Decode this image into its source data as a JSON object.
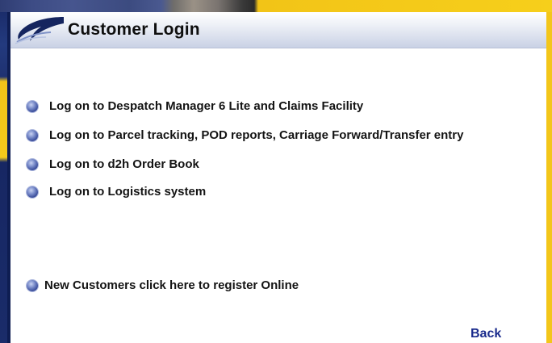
{
  "header": {
    "title": "Customer Login",
    "logo_icon": "swoosh-logo-icon"
  },
  "menu": {
    "items": [
      {
        "label": "Log on to Despatch Manager 6 Lite and Claims Facility",
        "icon": "bullet-icon"
      },
      {
        "label": "Log on to Parcel tracking, POD reports, Carriage Forward/Transfer entry",
        "icon": "bullet-icon"
      },
      {
        "label": "Log on to d2h Order Book",
        "icon": "bullet-icon"
      },
      {
        "label": "Log on to Logistics system",
        "icon": "bullet-icon"
      }
    ]
  },
  "register": {
    "label": "New Customers click here to register Online",
    "icon": "bullet-icon"
  },
  "back": {
    "label": "Back"
  },
  "colors": {
    "link_blue": "#1a2b8c",
    "brand_navy": "#1b2d6b",
    "brand_yellow": "#f3c61a",
    "header_gradient_end": "#c9d1e5"
  }
}
